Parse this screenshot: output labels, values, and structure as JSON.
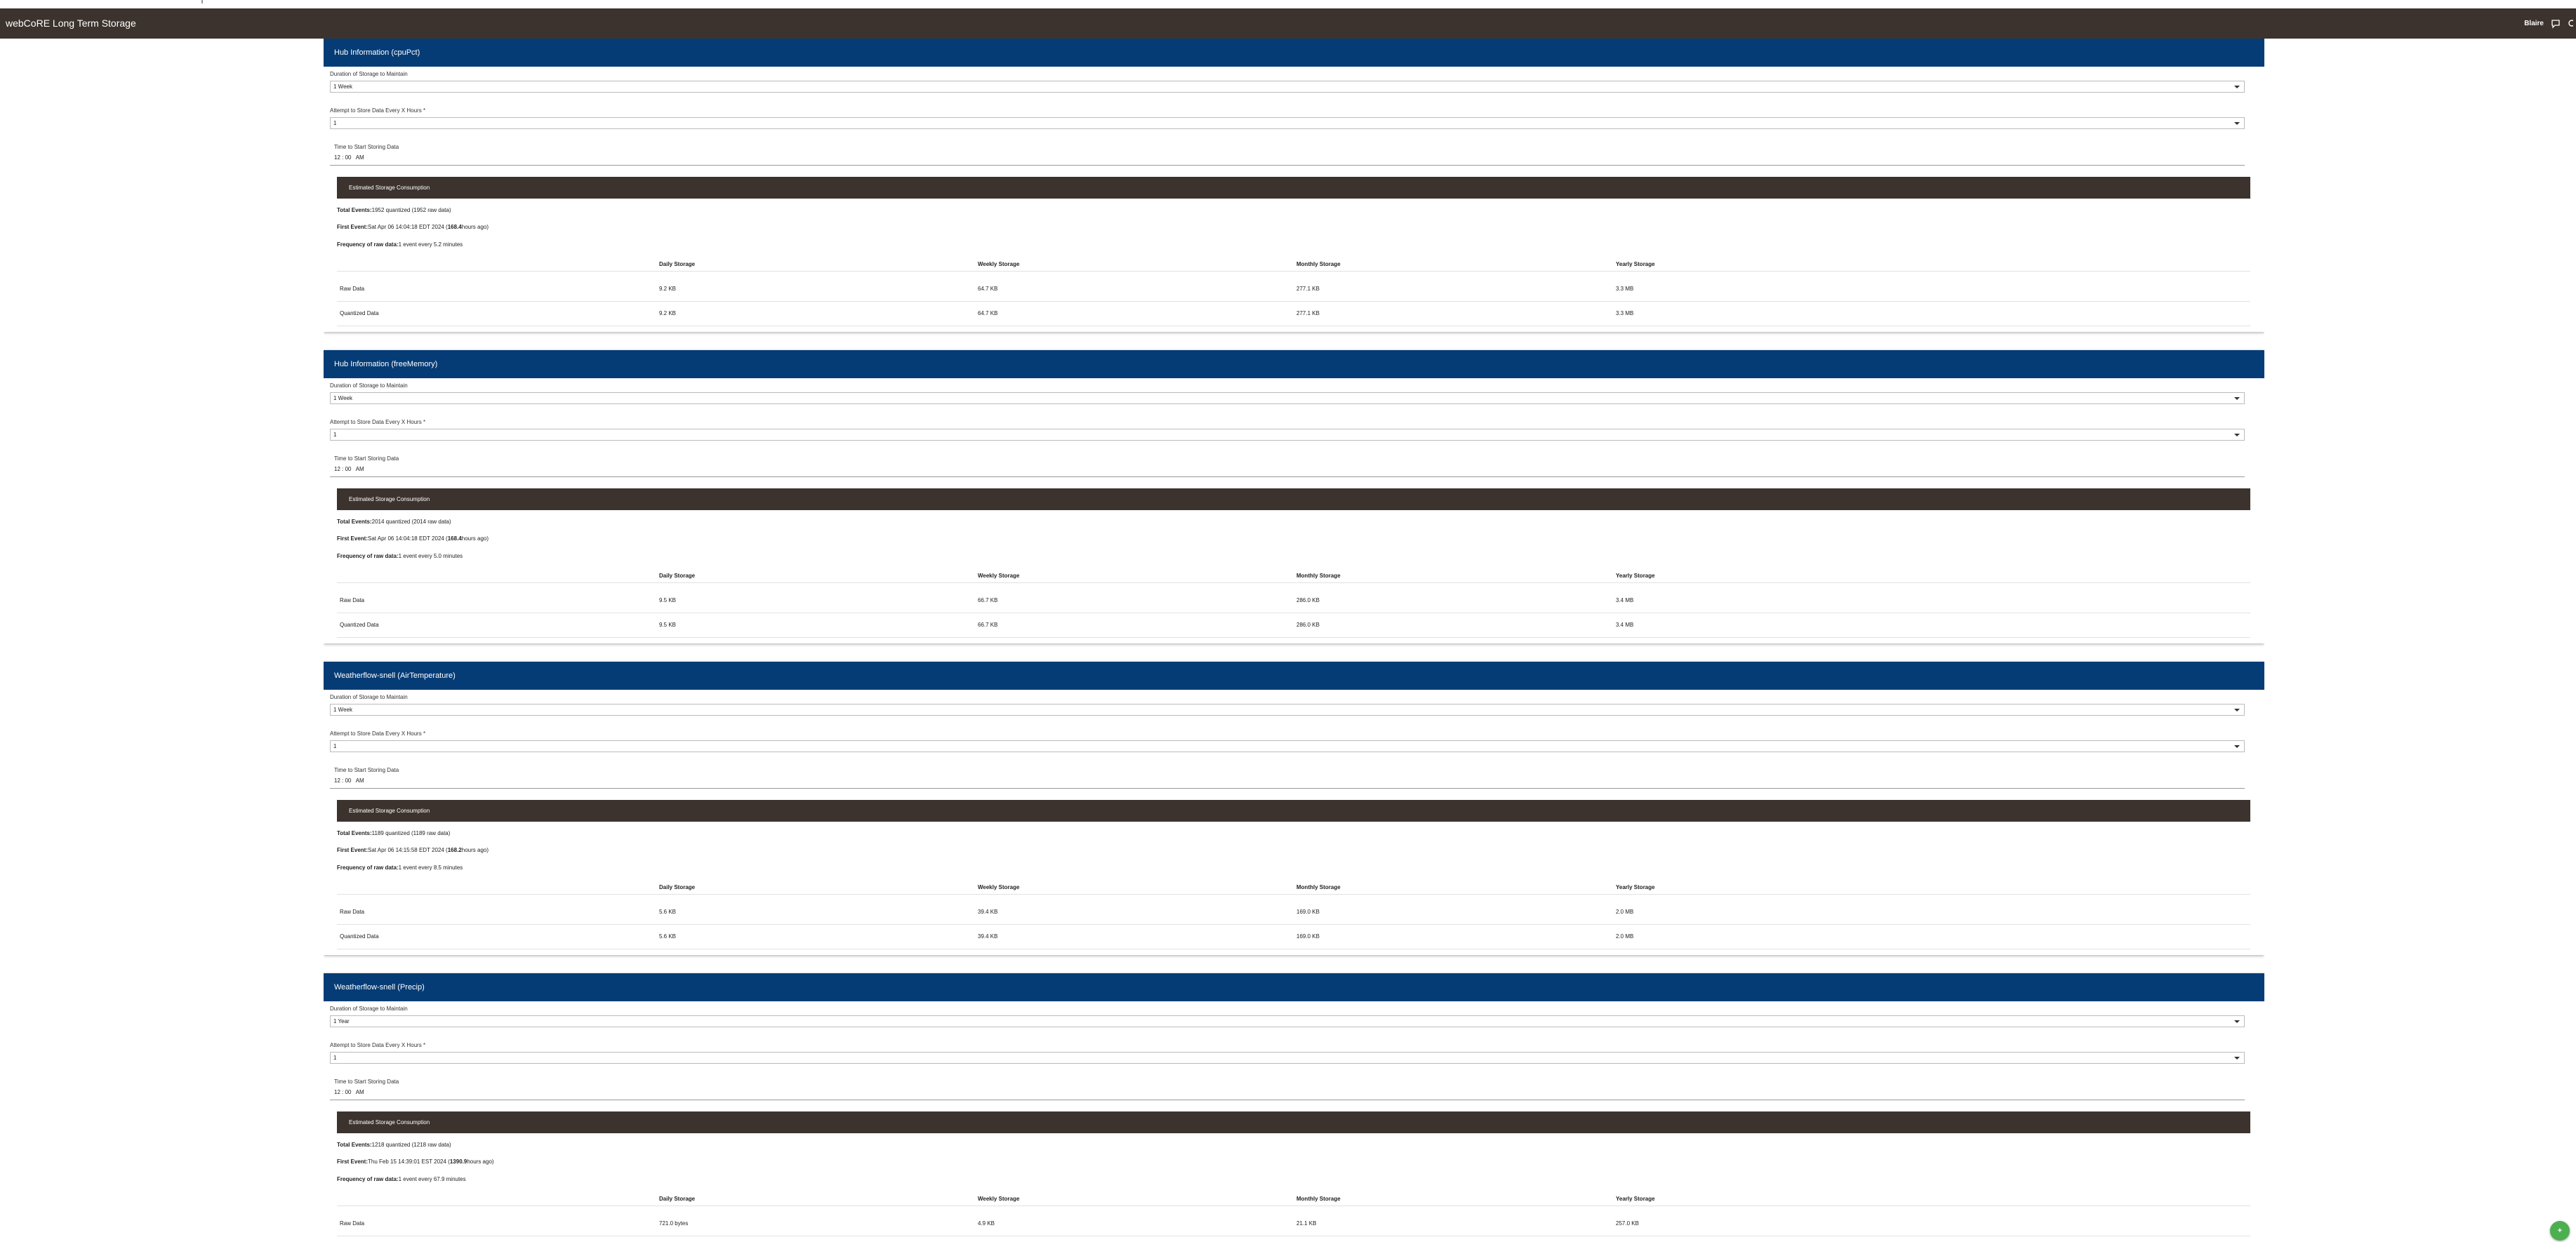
{
  "header": {
    "title": "webCoRE Long Term Storage",
    "user": "Blaire"
  },
  "fab_label": "+",
  "cards": [
    {
      "title": "Hub Information (cpuPct)",
      "duration_label": "Duration of Storage to Maintain",
      "duration_value": "1 Week",
      "interval_label": "Attempt to Store Data Every X Hours *",
      "interval_value": "1",
      "time_label": "Time to Start Storing Data",
      "time_value": "12 : 00   AM",
      "est_label": "Estimated Storage Consumption",
      "total_events_label": "Total Events:",
      "total_events_value": "1952 quantized (1952 raw data)",
      "first_event_label": "First Event:",
      "first_event_value": "Sat Apr 06 14:04:18 EDT 2024 (",
      "first_event_hours": "168.4",
      "first_event_suffix": "hours ago)",
      "frequency_label": "Frequency of raw data:",
      "frequency_value": "1 event every 5.2 minutes",
      "columns": [
        "",
        "Daily Storage",
        "Weekly Storage",
        "Monthly Storage",
        "Yearly Storage"
      ],
      "rows": [
        [
          "Raw Data",
          "9.2 KB",
          "64.7 KB",
          "277.1 KB",
          "3.3 MB"
        ],
        [
          "Quantized Data",
          "9.2 KB",
          "64.7 KB",
          "277.1 KB",
          "3.3 MB"
        ]
      ]
    },
    {
      "title": "Hub Information (freeMemory)",
      "duration_label": "Duration of Storage to Maintain",
      "duration_value": "1 Week",
      "interval_label": "Attempt to Store Data Every X Hours *",
      "interval_value": "1",
      "time_label": "Time to Start Storing Data",
      "time_value": "12 : 00   AM",
      "est_label": "Estimated Storage Consumption",
      "total_events_label": "Total Events:",
      "total_events_value": "2014 quantized (2014 raw data)",
      "first_event_label": "First Event:",
      "first_event_value": "Sat Apr 06 14:04:18 EDT 2024 (",
      "first_event_hours": "168.4",
      "first_event_suffix": "hours ago)",
      "frequency_label": "Frequency of raw data:",
      "frequency_value": "1 event every 5.0 minutes",
      "columns": [
        "",
        "Daily Storage",
        "Weekly Storage",
        "Monthly Storage",
        "Yearly Storage"
      ],
      "rows": [
        [
          "Raw Data",
          "9.5 KB",
          "66.7 KB",
          "286.0 KB",
          "3.4 MB"
        ],
        [
          "Quantized Data",
          "9.5 KB",
          "66.7 KB",
          "286.0 KB",
          "3.4 MB"
        ]
      ]
    },
    {
      "title": "Weatherflow-snell (AirTemperature)",
      "duration_label": "Duration of Storage to Maintain",
      "duration_value": "1 Week",
      "interval_label": "Attempt to Store Data Every X Hours *",
      "interval_value": "1",
      "time_label": "Time to Start Storing Data",
      "time_value": "12 : 00   AM",
      "est_label": "Estimated Storage Consumption",
      "total_events_label": "Total Events:",
      "total_events_value": "1189 quantized (1189 raw data)",
      "first_event_label": "First Event:",
      "first_event_value": "Sat Apr 06 14:15:58 EDT 2024 (",
      "first_event_hours": "168.2",
      "first_event_suffix": "hours ago)",
      "frequency_label": "Frequency of raw data:",
      "frequency_value": "1 event every 8.5 minutes",
      "columns": [
        "",
        "Daily Storage",
        "Weekly Storage",
        "Monthly Storage",
        "Yearly Storage"
      ],
      "rows": [
        [
          "Raw Data",
          "5.6 KB",
          "39.4 KB",
          "169.0 KB",
          "2.0 MB"
        ],
        [
          "Quantized Data",
          "5.6 KB",
          "39.4 KB",
          "169.0 KB",
          "2.0 MB"
        ]
      ]
    },
    {
      "title": "Weatherflow-snell (Precip)",
      "duration_label": "Duration of Storage to Maintain",
      "duration_value": "1 Year",
      "interval_label": "Attempt to Store Data Every X Hours *",
      "interval_value": "1",
      "time_label": "Time to Start Storing Data",
      "time_value": "12 : 00   AM",
      "est_label": "Estimated Storage Consumption",
      "total_events_label": "Total Events:",
      "total_events_value": "1218 quantized (1218 raw data)",
      "first_event_label": "First Event:",
      "first_event_value": "Thu Feb 15 14:39:01 EST 2024 (",
      "first_event_hours": "1390.9",
      "first_event_suffix": "hours ago)",
      "frequency_label": "Frequency of raw data:",
      "frequency_value": "1 event every 67.9 minutes",
      "columns": [
        "",
        "Daily Storage",
        "Weekly Storage",
        "Monthly Storage",
        "Yearly Storage"
      ],
      "rows": [
        [
          "Raw Data",
          "721.0 bytes",
          "4.9 KB",
          "21.1 KB",
          "257.0 KB"
        ]
      ]
    }
  ]
}
